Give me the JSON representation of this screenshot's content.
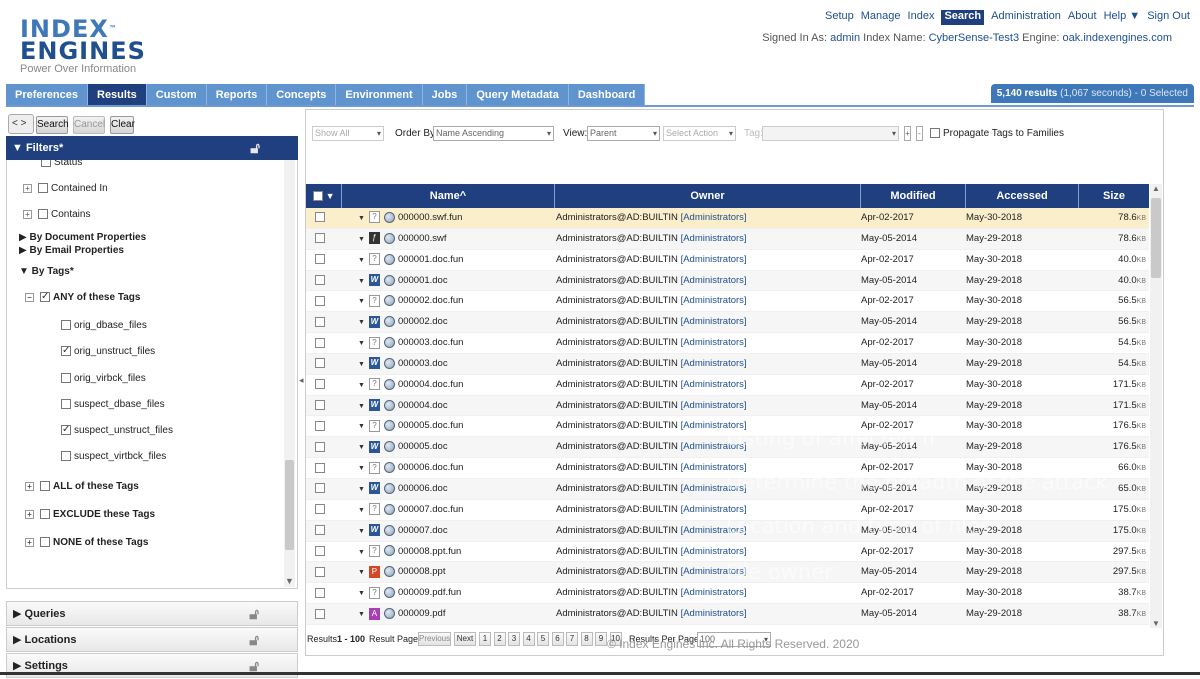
{
  "logo": {
    "line1": "INDEX",
    "tm": "™",
    "line2": "ENGINES",
    "tagline": "Power Over Information"
  },
  "topnav": [
    "Setup",
    "Manage",
    "Index",
    "Search",
    "Administration",
    "About",
    "Help ▼",
    "Sign Out"
  ],
  "signed_in": {
    "label": "Signed In As:",
    "user": "admin",
    "index_label": "Index Name:",
    "index": "CyberSense-Test3",
    "engine_label": "Engine:",
    "engine": "oak.indexengines.com"
  },
  "tabs": [
    "Preferences",
    "Results",
    "Custom",
    "Reports",
    "Concepts",
    "Environment",
    "Jobs",
    "Query Metadata",
    "Dashboard"
  ],
  "results_count": {
    "count": "5,140 results",
    "time": "(1,067 seconds)",
    "selected": "- 0 Selected"
  },
  "left_toolbar": {
    "search": "Search",
    "cancel": "Cancel",
    "clear": "Clear",
    "arrows": "< >"
  },
  "filters": {
    "title": "▼ Filters*",
    "status": "Status",
    "contained_in": "Contained In",
    "contains": "Contains",
    "doc_props": "▶ By Document Properties",
    "email_props": "▶ By Email Properties",
    "by_tags": "▼ By Tags*",
    "any_tags": "ANY of these Tags",
    "tags": [
      {
        "label": "orig_dbase_files"
      },
      {
        "label": "orig_unstruct_files"
      },
      {
        "label": "orig_virbck_files"
      },
      {
        "label": "suspect_dbase_files"
      },
      {
        "label": "suspect_unstruct_files"
      },
      {
        "label": "suspect_virtbck_files"
      }
    ],
    "all_tags": "ALL of these Tags",
    "exclude_tags": "EXCLUDE these Tags",
    "none_tags": "NONE of these Tags"
  },
  "accordions": [
    "▶ Queries",
    "▶ Locations",
    "▶ Settings"
  ],
  "toolbar": {
    "show": "Show All",
    "order_label": "Order By:",
    "order": "Name Ascending",
    "view_label": "View:",
    "view": "Parent",
    "action": "Select Action",
    "tag_label": "Tag:",
    "propagate": "Propagate Tags to Families"
  },
  "columns": {
    "check": "▼",
    "name": "Name",
    "owner": "Owner",
    "modified": "Modified",
    "accessed": "Accessed",
    "size": "Size"
  },
  "rows": [
    {
      "name": "000000.swf.fun",
      "icon": "generic",
      "owner": "Administrators@AD:BUILTIN",
      "group": "[Administrators]",
      "modified": "Apr-02-2017",
      "accessed": "May-30-2018",
      "size": "78.6",
      "unit": "KB"
    },
    {
      "name": "000000.swf",
      "icon": "swf",
      "owner": "Administrators@AD:BUILTIN",
      "group": "[Administrators]",
      "modified": "May-05-2014",
      "accessed": "May-29-2018",
      "size": "78.6",
      "unit": "KB"
    },
    {
      "name": "000001.doc.fun",
      "icon": "generic",
      "owner": "Administrators@AD:BUILTIN",
      "group": "[Administrators]",
      "modified": "Apr-02-2017",
      "accessed": "May-30-2018",
      "size": "40.0",
      "unit": "KB"
    },
    {
      "name": "000001.doc",
      "icon": "word",
      "owner": "Administrators@AD:BUILTIN",
      "group": "[Administrators]",
      "modified": "May-05-2014",
      "accessed": "May-29-2018",
      "size": "40.0",
      "unit": "KB"
    },
    {
      "name": "000002.doc.fun",
      "icon": "generic",
      "owner": "Administrators@AD:BUILTIN",
      "group": "[Administrators]",
      "modified": "Apr-02-2017",
      "accessed": "May-30-2018",
      "size": "56.5",
      "unit": "KB"
    },
    {
      "name": "000002.doc",
      "icon": "word",
      "owner": "Administrators@AD:BUILTIN",
      "group": "[Administrators]",
      "modified": "May-05-2014",
      "accessed": "May-29-2018",
      "size": "56.5",
      "unit": "KB"
    },
    {
      "name": "000003.doc.fun",
      "icon": "generic",
      "owner": "Administrators@AD:BUILTIN",
      "group": "[Administrators]",
      "modified": "Apr-02-2017",
      "accessed": "May-30-2018",
      "size": "54.5",
      "unit": "KB"
    },
    {
      "name": "000003.doc",
      "icon": "word",
      "owner": "Administrators@AD:BUILTIN",
      "group": "[Administrators]",
      "modified": "May-05-2014",
      "accessed": "May-29-2018",
      "size": "54.5",
      "unit": "KB"
    },
    {
      "name": "000004.doc.fun",
      "icon": "generic",
      "owner": "Administrators@AD:BUILTIN",
      "group": "[Administrators]",
      "modified": "Apr-02-2017",
      "accessed": "May-30-2018",
      "size": "171.5",
      "unit": "KB"
    },
    {
      "name": "000004.doc",
      "icon": "word",
      "owner": "Administrators@AD:BUILTIN",
      "group": "[Administrators]",
      "modified": "May-05-2014",
      "accessed": "May-29-2018",
      "size": "171.5",
      "unit": "KB"
    },
    {
      "name": "000005.doc.fun",
      "icon": "generic",
      "owner": "Administrators@AD:BUILTIN",
      "group": "[Administrators]",
      "modified": "Apr-02-2017",
      "accessed": "May-30-2018",
      "size": "176.5",
      "unit": "KB"
    },
    {
      "name": "000005.doc",
      "icon": "word",
      "owner": "Administrators@AD:BUILTIN",
      "group": "[Administrators]",
      "modified": "May-05-2014",
      "accessed": "May-29-2018",
      "size": "176.5",
      "unit": "KB"
    },
    {
      "name": "000006.doc.fun",
      "icon": "generic",
      "owner": "Administrators@AD:BUILTIN",
      "group": "[Administrators]",
      "modified": "Apr-02-2017",
      "accessed": "May-30-2018",
      "size": "66.0",
      "unit": "KB"
    },
    {
      "name": "000006.doc",
      "icon": "word",
      "owner": "Administrators@AD:BUILTIN",
      "group": "[Administrators]",
      "modified": "May-05-2014",
      "accessed": "May-29-2018",
      "size": "65.0",
      "unit": "KB"
    },
    {
      "name": "000007.doc.fun",
      "icon": "generic",
      "owner": "Administrators@AD:BUILTIN",
      "group": "[Administrators]",
      "modified": "Apr-02-2017",
      "accessed": "May-30-2018",
      "size": "175.0",
      "unit": "KB"
    },
    {
      "name": "000007.doc",
      "icon": "word",
      "owner": "Administrators@AD:BUILTIN",
      "group": "[Administrators]",
      "modified": "May-05-2014",
      "accessed": "May-29-2018",
      "size": "175.0",
      "unit": "KB"
    },
    {
      "name": "000008.ppt.fun",
      "icon": "generic",
      "owner": "Administrators@AD:BUILTIN",
      "group": "[Administrators]",
      "modified": "Apr-02-2017",
      "accessed": "May-30-2018",
      "size": "297.5",
      "unit": "KB"
    },
    {
      "name": "000008.ppt",
      "icon": "ppt",
      "owner": "Administrators@AD:BUILTIN",
      "group": "[Administrators]",
      "modified": "May-05-2014",
      "accessed": "May-29-2018",
      "size": "297.5",
      "unit": "KB"
    },
    {
      "name": "000009.pdf.fun",
      "icon": "generic",
      "owner": "Administrators@AD:BUILTIN",
      "group": "[Administrators]",
      "modified": "Apr-02-2017",
      "accessed": "May-30-2018",
      "size": "38.7",
      "unit": "KB"
    },
    {
      "name": "000009.pdf",
      "icon": "pdf",
      "owner": "Administrators@AD:BUILTIN",
      "group": "[Administrators]",
      "modified": "May-05-2014",
      "accessed": "May-29-2018",
      "size": "38.7",
      "unit": "KB"
    }
  ],
  "pager": {
    "results_label": "Results",
    "range": "1 - 100",
    "result_page": "Result Page:",
    "previous": "Previous",
    "next": "Next",
    "pages": [
      "1",
      "2",
      "3",
      "4",
      "5",
      "6",
      "7",
      "8",
      "9",
      "10"
    ],
    "per_page_label": "Results Per Page:",
    "per_page": "100"
  },
  "overlay_text": [
    "Listing of affected fi",
    "Determine the breadth of the attack",
    "Location and type of files",
    "File owner"
  ],
  "copyright": "© Index Engines Inc.  All Rights Reserved.  2020"
}
